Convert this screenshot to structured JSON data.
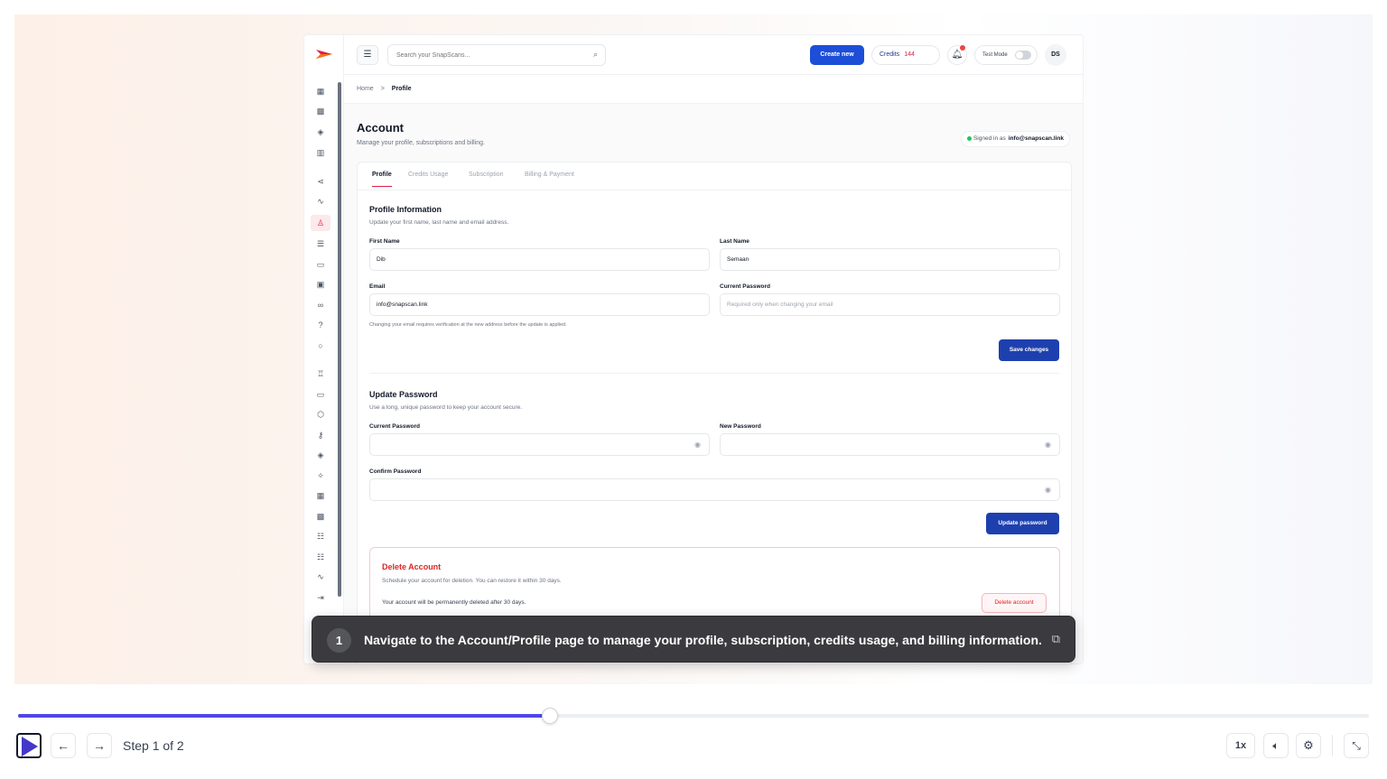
{
  "topbar": {
    "search_placeholder": "Search your SnapScans...",
    "create_label": "Create new",
    "credits_label": "Credits",
    "credits_count": "144",
    "test_mode_label": "Test Mode",
    "avatar_initials": "DS"
  },
  "breadcrumb": {
    "home": "Home",
    "separator": ">",
    "current": "Profile"
  },
  "page": {
    "title": "Account",
    "subtitle": "Manage your profile, subscriptions and billing.",
    "signed_in_prefix": "Signed in as",
    "signed_in_email": "info@snapscan.link"
  },
  "tabs": [
    "Profile",
    "Credits Usage",
    "Subscription",
    "Billing & Payment"
  ],
  "profile": {
    "title": "Profile Information",
    "subtitle": "Update your first name, last name and email address.",
    "first_name_label": "First Name",
    "first_name_value": "Dib",
    "last_name_label": "Last Name",
    "last_name_value": "Semaan",
    "email_label": "Email",
    "email_value": "info@snapscan.link",
    "current_password_label": "Current Password",
    "current_password_placeholder": "Required only when changing your email",
    "email_hint": "Changing your email requires verification at the new address before the update is applied.",
    "save_label": "Save changes"
  },
  "password": {
    "title": "Update Password",
    "subtitle": "Use a long, unique password to keep your account secure.",
    "current_label": "Current Password",
    "new_label": "New Password",
    "confirm_label": "Confirm Password",
    "update_label": "Update password"
  },
  "danger": {
    "title": "Delete Account",
    "subtitle": "Schedule your account for deletion. You can restore it within 30 days.",
    "note": "Your account will be permanently deleted after 30 days.",
    "button_label": "Delete account"
  },
  "tooltip": {
    "step_number": "1",
    "message": "Navigate to the Account/Profile page to manage your profile, subscription, credits usage, and billing information."
  },
  "player": {
    "step_text": "Step 1 of 2",
    "speed_label": "1x",
    "progress_fraction": 0.394
  },
  "sidebar_icons": [
    "grid-icon",
    "qr-icon",
    "layers-icon",
    "chart-icon",
    "share-icon",
    "activity-icon",
    "user-icon",
    "list-icon",
    "card-icon",
    "document-icon",
    "link-icon",
    "help-icon",
    "chat-icon",
    "team-icon",
    "billing-icon",
    "shield-icon",
    "key-icon",
    "stack-icon",
    "sparkle-icon",
    "table-icon",
    "qr-code-icon",
    "checklist-icon",
    "tasks-icon",
    "pulse-icon",
    "logout-icon"
  ],
  "colors": {
    "primary": "#1e40af",
    "accent": "#e11d48",
    "danger": "#dc2626",
    "progress": "#4f46e5"
  }
}
